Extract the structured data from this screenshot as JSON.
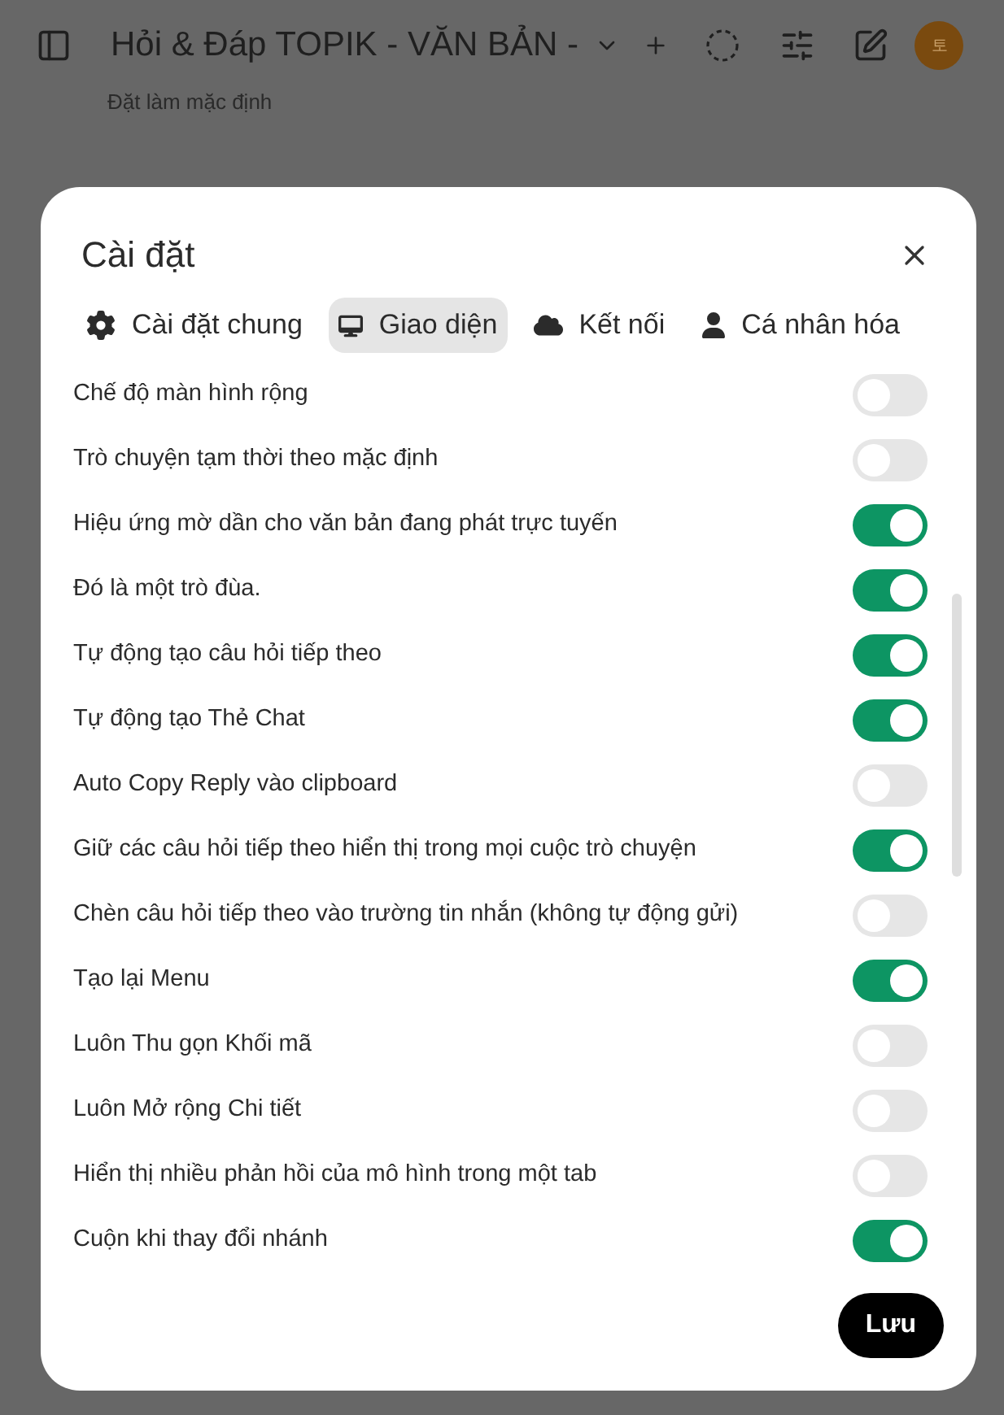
{
  "header": {
    "title": "Hỏi & Đáp TOPIK - VĂN BẢN -",
    "subtitle": "Đặt làm mặc định",
    "avatar": "토"
  },
  "dialog": {
    "title": "Cài đặt",
    "tabs": [
      {
        "label": "Cài đặt chung",
        "kind": "gear",
        "selected": false
      },
      {
        "label": "Giao diện",
        "kind": "monitor",
        "selected": true
      },
      {
        "label": "Kết nối",
        "kind": "cloud",
        "selected": false
      },
      {
        "label": "Cá nhân hóa",
        "kind": "user",
        "selected": false
      }
    ],
    "settings": [
      {
        "label": "Chế độ màn hình rộng",
        "on": false
      },
      {
        "label": "Trò chuyện tạm thời theo mặc định",
        "on": false
      },
      {
        "label": "Hiệu ứng mờ dần cho văn bản đang phát trực tuyến",
        "on": true
      },
      {
        "label": "Đó là một trò đùa.",
        "on": true
      },
      {
        "label": "Tự động tạo câu hỏi tiếp theo",
        "on": true
      },
      {
        "label": "Tự động tạo Thẻ Chat",
        "on": true
      },
      {
        "label": "Auto Copy Reply vào clipboard",
        "on": false
      },
      {
        "label": "Giữ các câu hỏi tiếp theo hiển thị trong mọi cuộc trò chuyện",
        "on": true
      },
      {
        "label": "Chèn câu hỏi tiếp theo vào trường tin nhắn (không tự động gửi)",
        "on": false
      },
      {
        "label": "Tạo lại Menu",
        "on": true
      },
      {
        "label": "Luôn Thu gọn Khối mã",
        "on": false
      },
      {
        "label": "Luôn Mở rộng Chi tiết",
        "on": false
      },
      {
        "label": "Hiển thị nhiều phản hồi của mô hình trong một tab",
        "on": false
      },
      {
        "label": "Cuộn khi thay đổi nhánh",
        "on": true
      }
    ],
    "save": "Lưu"
  }
}
